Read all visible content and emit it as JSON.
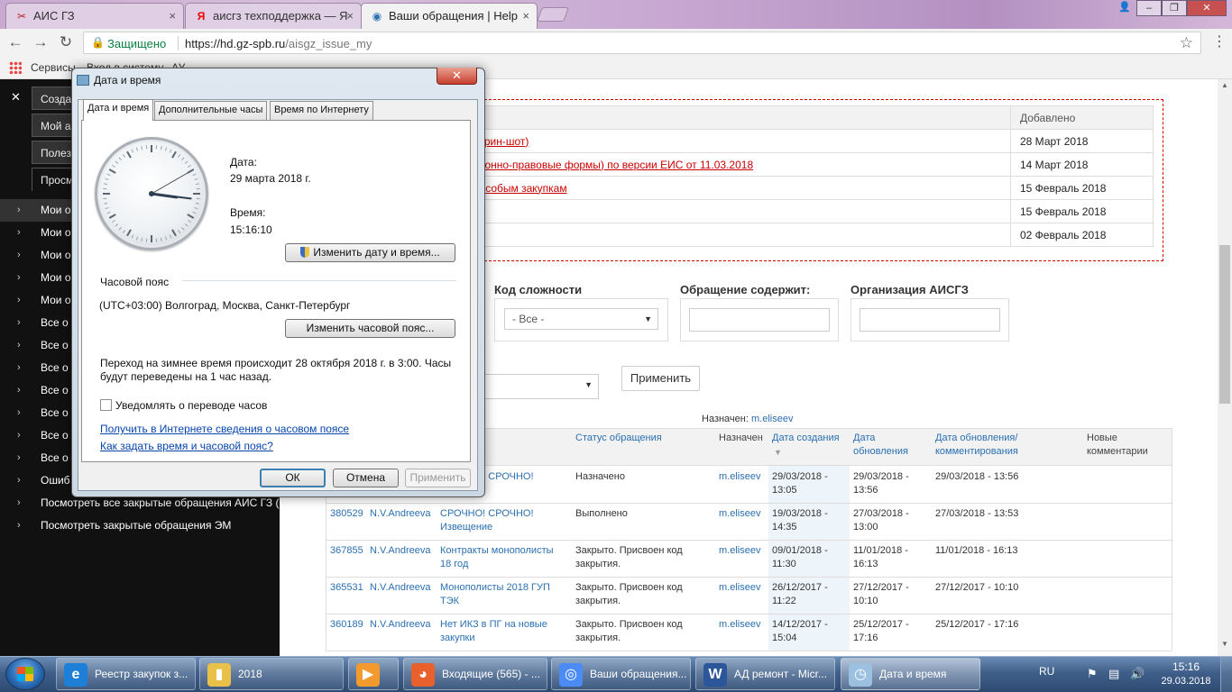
{
  "browser": {
    "tabs": [
      {
        "title": "АИС ГЗ",
        "icon": "ais-logo-icon"
      },
      {
        "title": "аисгз техподдержка — Я",
        "icon": "yandex-icon"
      },
      {
        "title": "Ваши обращения | Help",
        "icon": "helpdesk-icon"
      }
    ],
    "secure_label": "Защищено",
    "url_host": "https://hd.gz-spb.ru",
    "url_path": "/aisgz_issue_my",
    "bookmarks": [
      "Сервисы",
      "Вход в систему...АУ"
    ]
  },
  "sidebar": {
    "tabs": [
      "Созда",
      "Мой а",
      "Полез",
      "Просм"
    ],
    "items": [
      "Мои о",
      "Мои о",
      "Мои о",
      "Мои о",
      "Мои о",
      "Все о",
      "Все о",
      "Все о",
      "Все о",
      "Все о",
      "Все о",
      "Все о",
      "Ошиб",
      "Посмотреть все закрытые обращения АИС ГЗ (пла",
      "Посмотреть закрытые обращения ЭМ"
    ]
  },
  "news": {
    "header_date": "Добавлено",
    "rows": [
      {
        "title": "на (скрин-шот)",
        "date": "28 Март 2018"
      },
      {
        "title": "изационно-правовые формы) по версии ЕИС от 11.03.2018",
        "date": "14 Март 2018"
      },
      {
        "title": "а по особым закупкам",
        "date": "15 Февраль 2018"
      },
      {
        "title": "",
        "date": "15 Февраль 2018"
      },
      {
        "title": "",
        "date": "02 Февраль 2018"
      }
    ]
  },
  "filters": {
    "complexity_label": "Код сложности",
    "complexity_value": "- Все -",
    "contains_label": "Обращение содержит:",
    "org_label": "Организация АИСГЗ",
    "apply_label": "Применить",
    "assigned_label": "Назначен:",
    "assigned_user": "m.eliseev"
  },
  "issues": {
    "headers": {
      "status": "Статус обращения",
      "assigned": "Назначен",
      "created": "Дата создания",
      "updated": "Дата обновления",
      "updated_commented": "Дата обновления/ комментирования",
      "new_comments": "Новые комментарии"
    },
    "rows": [
      {
        "id": "",
        "author": "",
        "subject": "СРОЧНО! СРОЧНО!",
        "status": "Назначено",
        "assigned": "m.eliseev",
        "created": "29/03/2018 - 13:05",
        "updated": "29/03/2018 - 13:56",
        "updated_c": "29/03/2018 - 13:56"
      },
      {
        "id": "380529",
        "author": "N.V.Andreeva",
        "subject": "СРОЧНО! СРОЧНО! Извещение",
        "status": "Выполнено",
        "assigned": "m.eliseev",
        "created": "19/03/2018 - 14:35",
        "updated": "27/03/2018 - 13:00",
        "updated_c": "27/03/2018 - 13:53"
      },
      {
        "id": "367855",
        "author": "N.V.Andreeva",
        "subject": "Контракты монополисты 18 год",
        "status": "Закрыто. Присвоен код закрытия.",
        "assigned": "m.eliseev",
        "created": "09/01/2018 - 11:30",
        "updated": "11/01/2018 - 16:13",
        "updated_c": "11/01/2018 - 16:13"
      },
      {
        "id": "365531",
        "author": "N.V.Andreeva",
        "subject": "Монополисты 2018 ГУП ТЭК",
        "status": "Закрыто. Присвоен код закрытия.",
        "assigned": "m.eliseev",
        "created": "26/12/2017 - 11:22",
        "updated": "27/12/2017 - 10:10",
        "updated_c": "27/12/2017 - 10:10"
      },
      {
        "id": "360189",
        "author": "N.V.Andreeva",
        "subject": "Нет ИКЗ в ПГ на новые закупки",
        "status": "Закрыто. Присвоен код закрытия.",
        "assigned": "m.eliseev",
        "created": "14/12/2017 - 15:04",
        "updated": "25/12/2017 - 17:16",
        "updated_c": "25/12/2017 - 17:16"
      }
    ]
  },
  "dialog": {
    "title": "Дата и время",
    "tabs": [
      "Дата и время",
      "Дополнительные часы",
      "Время по Интернету"
    ],
    "date_label": "Дата:",
    "date_value": "29 марта 2018 г.",
    "time_label": "Время:",
    "time_value": "15:16:10",
    "change_datetime_button": "Изменить дату и время...",
    "timezone_label": "Часовой пояс",
    "timezone_value": "(UTC+03:00) Волгоград, Москва, Санкт-Петербург",
    "change_timezone_button": "Изменить часовой пояс...",
    "dst_line1": "Переход на зимнее время происходит 28 октября 2018 г. в 3:00. Часы",
    "dst_line2": "будут переведены на 1 час назад.",
    "notify_label": "Уведомлять о переводе часов",
    "link_tz_info": "Получить в Интернете сведения о часовом поясе",
    "link_howto": "Как задать время и часовой пояс?",
    "ok": "ОК",
    "cancel": "Отмена",
    "apply": "Применить",
    "clock": {
      "hours": 15,
      "minutes": 16,
      "seconds": 10
    }
  },
  "taskbar": {
    "items": [
      {
        "label": "Реестр закупок з...",
        "icon": "ie-icon"
      },
      {
        "label": "2018",
        "icon": "folder-icon"
      },
      {
        "label": "",
        "icon": "media-player-icon"
      },
      {
        "label": "Входящие (565) - ...",
        "icon": "firefox-icon"
      },
      {
        "label": "Ваши обращения...",
        "icon": "chrome-icon"
      },
      {
        "label": "АД ремонт - Micr...",
        "icon": "word-icon"
      },
      {
        "label": "Дата и время",
        "icon": "datetime-icon"
      }
    ],
    "lang": "RU",
    "time": "15:16",
    "date": "29.03.2018"
  }
}
